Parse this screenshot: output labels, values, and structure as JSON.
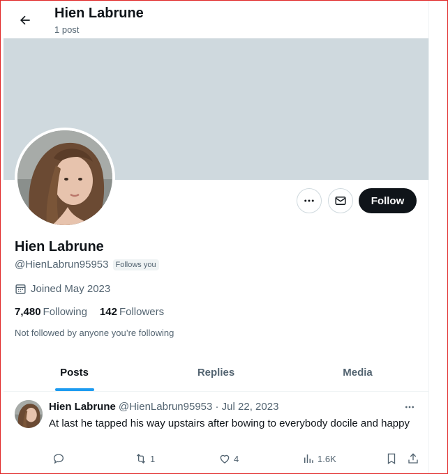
{
  "header": {
    "title": "Hien Labrune",
    "post_count": "1 post"
  },
  "profile": {
    "name": "Hien Labrune",
    "handle": "@HienLabrun95953",
    "follows_you_badge": "Follows you",
    "joined": "Joined May 2023",
    "following_count": "7,480",
    "following_label": "Following",
    "followers_count": "142",
    "followers_label": "Followers",
    "not_followed_text": "Not followed by anyone you’re following",
    "follow_button": "Follow"
  },
  "tabs": [
    {
      "label": "Posts",
      "active": true
    },
    {
      "label": "Replies",
      "active": false
    },
    {
      "label": "Media",
      "active": false
    }
  ],
  "post": {
    "name": "Hien Labrune",
    "handle_date": "@HienLabrun95953 · Jul 22, 2023",
    "text": "At last he tapped his way upstairs after bowing to everybody docile and happy",
    "retweets": "1",
    "likes": "4",
    "views": "1.6K"
  },
  "colors": {
    "banner": "#cfd9de",
    "accent": "#1d9bf0",
    "follow_button": "#0f1419",
    "frame": "#e02424"
  },
  "icons": [
    "back-arrow-icon",
    "more-icon",
    "mail-icon",
    "calendar-icon",
    "reply-icon",
    "retweet-icon",
    "like-icon",
    "views-icon",
    "bookmark-icon",
    "share-icon"
  ]
}
